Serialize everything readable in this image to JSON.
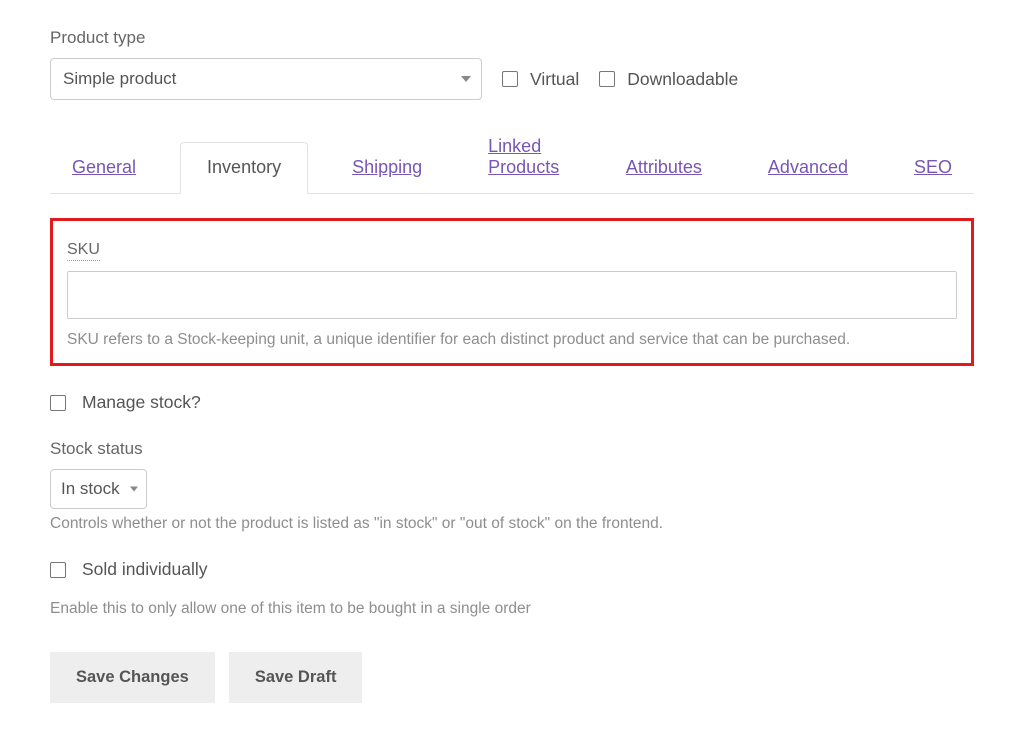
{
  "product_type": {
    "label": "Product type",
    "selected": "Simple product"
  },
  "flags": {
    "virtual": "Virtual",
    "downloadable": "Downloadable"
  },
  "tabs": {
    "general": "General",
    "inventory": "Inventory",
    "shipping": "Shipping",
    "linked_products": "Linked Products",
    "attributes": "Attributes",
    "advanced": "Advanced",
    "seo": "SEO"
  },
  "sku": {
    "label": "SKU",
    "value": "",
    "help": "SKU refers to a Stock-keeping unit, a unique identifier for each distinct product and service that can be purchased."
  },
  "manage_stock": {
    "label": "Manage stock?"
  },
  "stock_status": {
    "label": "Stock status",
    "selected": "In stock",
    "help": "Controls whether or not the product is listed as \"in stock\" or \"out of stock\" on the frontend."
  },
  "sold_individually": {
    "label": "Sold individually",
    "help": "Enable this to only allow one of this item to be bought in a single order"
  },
  "buttons": {
    "save_changes": "Save Changes",
    "save_draft": "Save Draft"
  }
}
